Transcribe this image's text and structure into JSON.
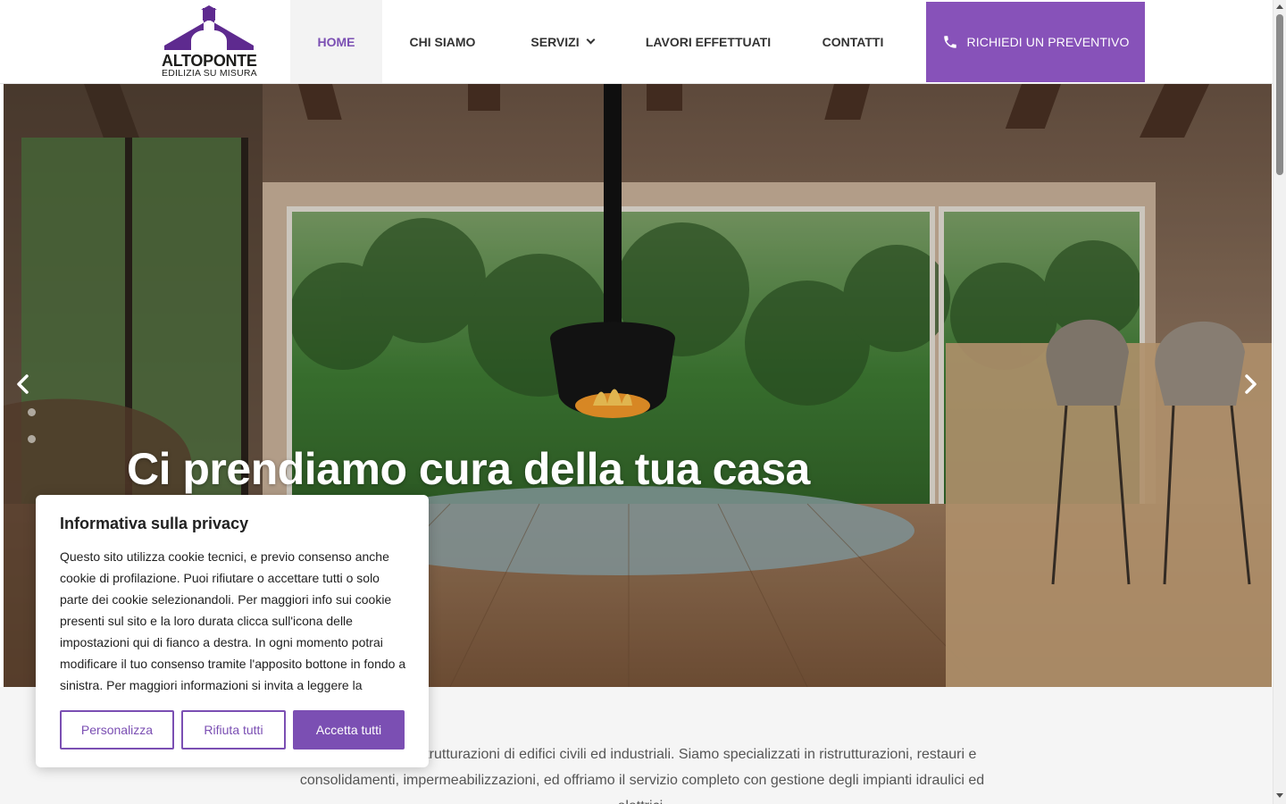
{
  "brand": {
    "name": "ALTOPONTE",
    "tagline": "EDILIZIA SU MISURA",
    "logo_icon": "house-roof-logo"
  },
  "nav": {
    "items": [
      {
        "label": "HOME",
        "active": true
      },
      {
        "label": "CHI SIAMO",
        "active": false
      },
      {
        "label": "SERVIZI",
        "active": false,
        "has_dropdown": true
      },
      {
        "label": "LAVORI EFFETTUATI",
        "active": false
      },
      {
        "label": "CONTATTI",
        "active": false
      }
    ],
    "cta": {
      "label": "RICHIEDI UN PREVENTIVO",
      "icon": "phone-icon"
    }
  },
  "hero": {
    "title": "Ci prendiamo cura della tua casa",
    "prev_icon": "chevron-left-icon",
    "next_icon": "chevron-right-icon",
    "slide_count_dots": 2
  },
  "intro": {
    "text": "ci occupiamo di ristrutturazioni di edifici civili ed industriali. Siamo specializzati in ristrutturazioni, restauri e consolidamenti, impermeabilizzazioni, ed offriamo il servizio completo con gestione degli impianti idraulici ed elettrici."
  },
  "cookie_banner": {
    "title": "Informativa sulla privacy",
    "text": "Questo sito utilizza cookie tecnici, e previo consenso anche cookie di profilazione. Puoi rifiutare o accettare tutti o solo parte dei cookie selezionandoli. Per maggiori info sui cookie presenti sul sito e la loro durata clicca sull'icona delle impostazioni qui di fianco a destra. In ogni momento potrai modificare il tuo consenso tramite l'apposito bottone in fondo a sinistra. Per maggiori informazioni si invita a leggere la",
    "buttons": {
      "customize": "Personalizza",
      "reject": "Rifiuta tutti",
      "accept": "Accetta tutti"
    }
  },
  "colors": {
    "brand_purple": "#8752b9",
    "button_purple": "#7b4fb3"
  }
}
